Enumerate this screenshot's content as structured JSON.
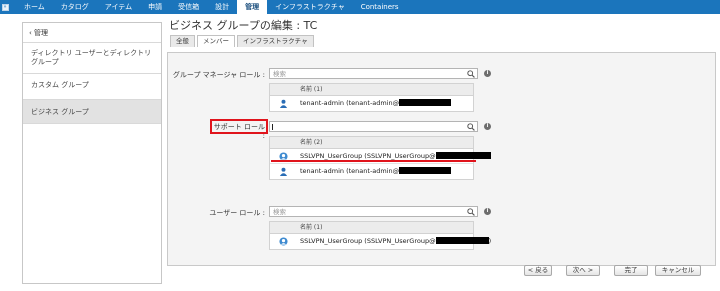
{
  "nav": {
    "items": [
      "ホーム",
      "カタログ",
      "アイテム",
      "申請",
      "受信箱",
      "設計",
      "管理",
      "インフラストラクチャ",
      "Containers"
    ],
    "active_index": 6
  },
  "sidebar": {
    "back_label": "‹ 管理",
    "items": [
      {
        "label": "ディレクトリ ユーザーとディレクトリ グループ"
      },
      {
        "label": "カスタム グループ"
      },
      {
        "label": "ビジネス グループ"
      }
    ],
    "selected_index": 2
  },
  "page": {
    "title": "ビジネス グループの編集 : TC",
    "tabs": [
      "全般",
      "メンバー",
      "インフラストラクチャ"
    ],
    "active_tab": 1
  },
  "form": {
    "group_manager": {
      "label": "グループ マネージャ ロール :",
      "search_placeholder": "検索",
      "column_header": "名前 (1)",
      "rows": [
        {
          "name": "tenant-admin (tenant-admin@",
          "icon": "user-icon"
        }
      ]
    },
    "support": {
      "label": "サポート ロール :",
      "search_value": "",
      "column_header": "名前 (2)",
      "rows": [
        {
          "name": "SSLVPN_UserGroup (SSLVPN_UserGroup@",
          "icon": "group-icon"
        },
        {
          "name": "tenant-admin (tenant-admin@",
          "icon": "user-icon"
        }
      ]
    },
    "user": {
      "label": "ユーザー ロール :",
      "search_placeholder": "検索",
      "column_header": "名前 (1)",
      "rows": [
        {
          "name": "SSLVPN_UserGroup (SSLVPN_UserGroup@",
          "icon": "group-icon",
          "suffix": ")"
        }
      ]
    }
  },
  "footer": {
    "back_label": "< 戻る",
    "next_label": "次へ >",
    "finish_label": "完了",
    "cancel_label": "キャンセル"
  },
  "colors": {
    "nav_bg": "#1b75bc",
    "highlight": "#e0141c"
  }
}
